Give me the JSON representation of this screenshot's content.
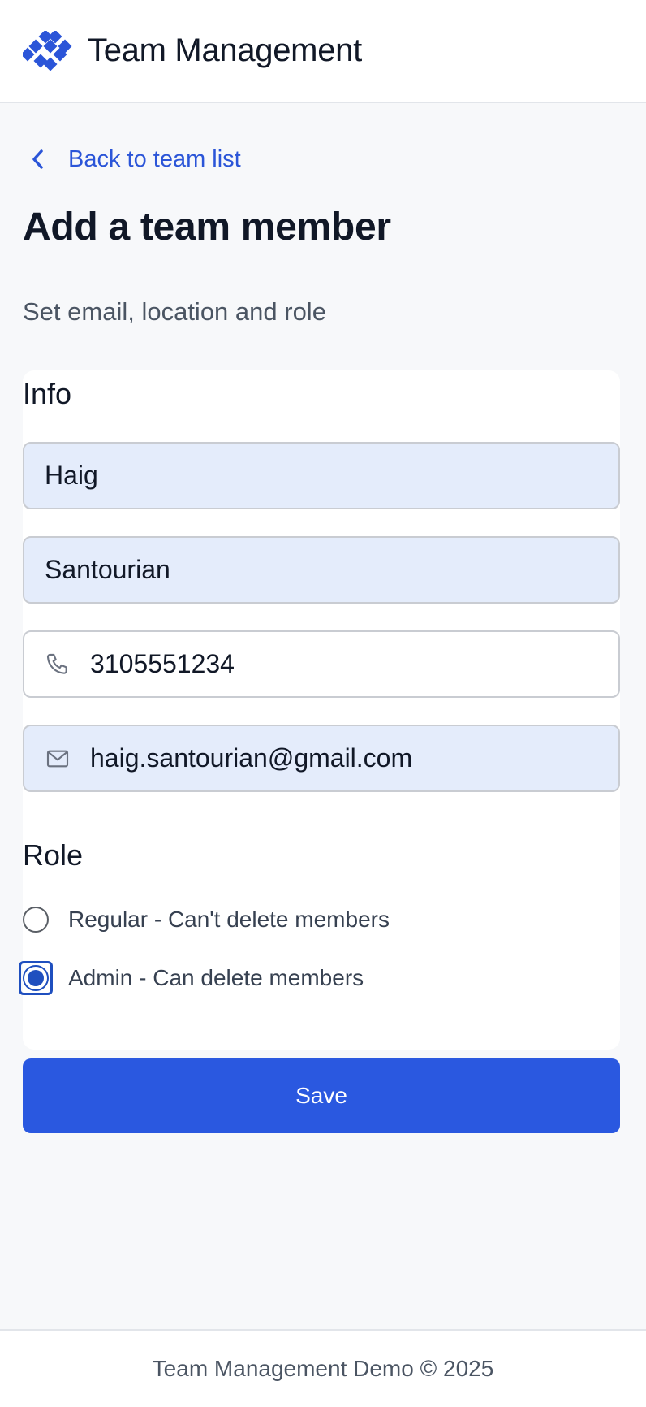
{
  "header": {
    "title": "Team Management",
    "logo_icon": "diamond-cluster-logo",
    "brand_color": "#2b55d8"
  },
  "nav": {
    "back_label": "Back to team list"
  },
  "page": {
    "title": "Add a team member",
    "subtitle": "Set email, location and role"
  },
  "info": {
    "section_title": "Info",
    "first_name": "Haig",
    "last_name": "Santourian",
    "phone": "3105551234",
    "phone_icon": "phone-icon",
    "email": "haig.santourian@gmail.com",
    "email_icon": "mail-icon"
  },
  "role": {
    "section_title": "Role",
    "options": [
      {
        "label": "Regular - Can't delete members",
        "selected": false
      },
      {
        "label": "Admin - Can delete members",
        "selected": true
      }
    ]
  },
  "actions": {
    "save_label": "Save",
    "save_color": "#2a58e0"
  },
  "footer": {
    "text": "Team Management Demo © 2025"
  }
}
